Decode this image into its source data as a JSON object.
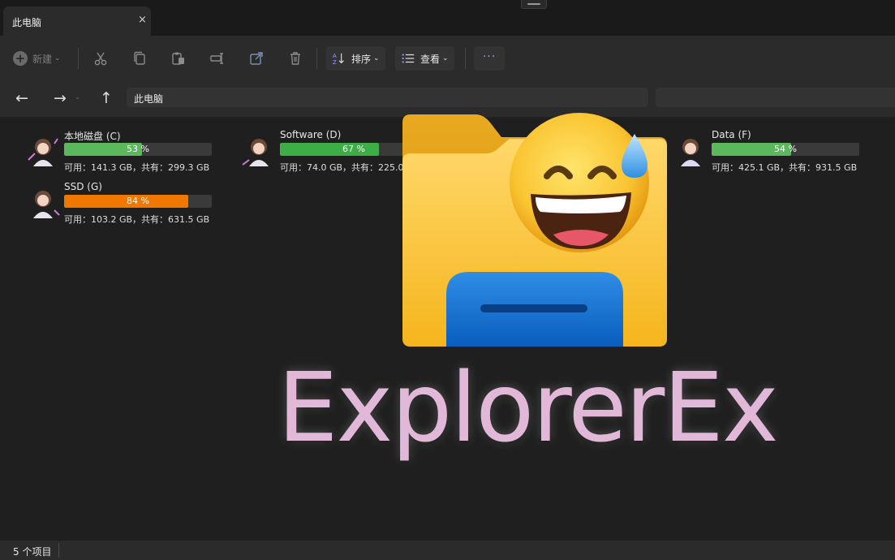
{
  "tab": {
    "title": "此电脑",
    "close": "×"
  },
  "toolbar": {
    "new_label": "新建",
    "sort_label": "排序",
    "view_label": "查看",
    "more_label": "···",
    "icons": [
      "cut-icon",
      "copy-icon",
      "paste-icon",
      "rename-icon",
      "share-icon",
      "delete-icon",
      "sort-icon",
      "view-icon"
    ]
  },
  "nav": {
    "back": "←",
    "forward": "→",
    "up": "↑"
  },
  "address": {
    "path": "此电脑"
  },
  "drives": [
    {
      "name": "本地磁盘 (C)",
      "percent": 53,
      "percent_label": "53 %",
      "info": "可用：141.3 GB，共有：299.3 GB",
      "bar_color": "#5cb85c"
    },
    {
      "name": "Software (D)",
      "percent": 67,
      "percent_label": "67 %",
      "info": "可用：74.0 GB，共有：225.0 GB",
      "bar_color": "#3cae45"
    },
    {
      "name": "Data (F)",
      "percent": 54,
      "percent_label": "54 %",
      "info": "可用：425.1 GB，共有：931.5 GB",
      "bar_color": "#5cb85c"
    },
    {
      "name": "SSD (G)",
      "percent": 84,
      "percent_label": "84 %",
      "info": "可用：103.2 GB，共有：631.5 GB",
      "bar_color": "#f07800"
    }
  ],
  "status": {
    "count_label": "5 个项目"
  },
  "overlay": {
    "title": "ExplorerEx"
  },
  "colors": {
    "accent": "#9a9cff",
    "warning": "#f07800",
    "ok": "#3cae45"
  }
}
